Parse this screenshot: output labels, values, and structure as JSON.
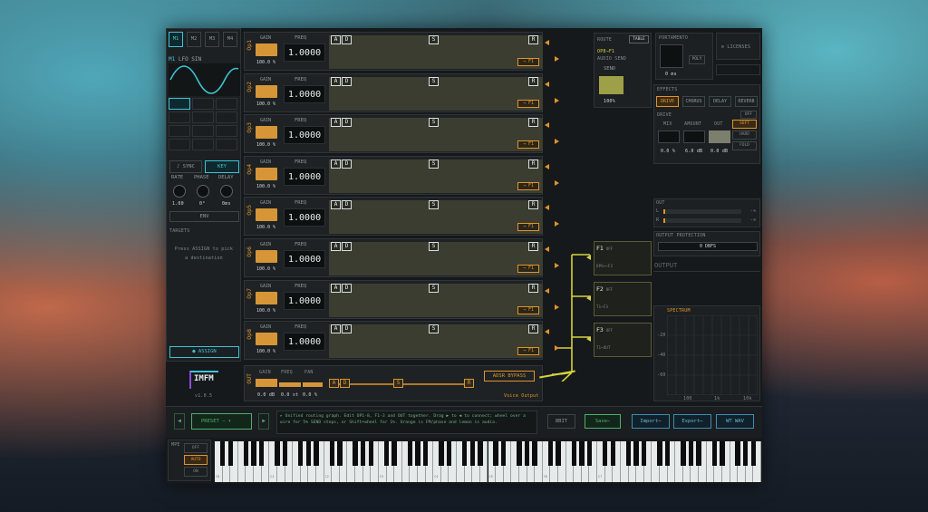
{
  "tabs": [
    "M1",
    "M2",
    "M3",
    "M4"
  ],
  "lfo": {
    "title": "M1",
    "subtitle": "LFO SIN",
    "sync_label": "♪ SYNC",
    "key_label": "KEY",
    "rate_label": "RATE",
    "phase_label": "PHASE",
    "delay_label": "DELAY",
    "rate_value": "1.00",
    "phase_value": "0°",
    "delay_value": "0ms",
    "env_label": "ENV",
    "targets_label": "TARGETS",
    "targets_hint": "Press ASSIGN to pick a destination",
    "assign_label": "● ASSIGN"
  },
  "logo": {
    "text": "IMFM",
    "version": "v1.0.5"
  },
  "operators": [
    {
      "name": "Op1",
      "gain": "100.0 %",
      "freq": "1.0000",
      "route": "→ F1"
    },
    {
      "name": "Op2",
      "gain": "100.0 %",
      "freq": "1.0000",
      "route": "→ F1"
    },
    {
      "name": "Op3",
      "gain": "100.0 %",
      "freq": "1.0000",
      "route": "→ F1"
    },
    {
      "name": "Op4",
      "gain": "100.0 %",
      "freq": "1.0000",
      "route": "→ F1"
    },
    {
      "name": "Op5",
      "gain": "100.0 %",
      "freq": "1.0000",
      "route": "→ F1"
    },
    {
      "name": "Op6",
      "gain": "100.0 %",
      "freq": "1.0000",
      "route": "→ F1"
    },
    {
      "name": "Op7",
      "gain": "100.0 %",
      "freq": "1.0000",
      "route": "→ F1"
    },
    {
      "name": "Op8",
      "gain": "100.0 %",
      "freq": "1.0000",
      "route": "→ F1"
    }
  ],
  "op_labels": {
    "gain": "GAIN",
    "freq": "FREQ",
    "a": "A",
    "d": "D",
    "s": "S",
    "r": "R"
  },
  "out_row": {
    "name": "OUT",
    "gain_label": "GAIN",
    "freq_label": "FREQ",
    "pan_label": "PAN",
    "gain_value": "0.0 dB",
    "freq_value": "0.0 st",
    "pan_value": "0.0 %",
    "bypass_label": "ADSR BYPASS",
    "voice_output": "Voice Output"
  },
  "route_panel": {
    "title": "ROUTE",
    "table_label": "TABLE",
    "line1": "OP8→F1",
    "line2": "AUDIO SEND",
    "send_label": "SEND",
    "send_value": "100%"
  },
  "filters": [
    {
      "name": "F1",
      "sub": "OFF",
      "route": "OP6+→F2"
    },
    {
      "name": "F2",
      "sub": "OFF",
      "route": "T1→F3"
    },
    {
      "name": "F3",
      "sub": "OFF",
      "route": "T1→OUT"
    }
  ],
  "portamento": {
    "title": "PORTAMENTO",
    "poly_label": "POLY",
    "value": "0 ms"
  },
  "licenses_label": "⚙ LICENSES",
  "effects": {
    "title": "EFFECTS",
    "tabs": [
      "DRIVE",
      "CHORUS",
      "DELAY",
      "REVERB"
    ],
    "off_label": "OFF",
    "drive_label": "DRIVE",
    "mix_label": "MIX",
    "amount_label": "AMOUNT",
    "out_label": "OUT",
    "mix_value": "0.0 %",
    "amount_value": "6.0 dB",
    "out_value": "0.0 dB",
    "modes": [
      "SOFT",
      "HARD",
      "FOLD"
    ]
  },
  "out_meter": {
    "title": "OUT",
    "l": "L",
    "r": "R",
    "l_db": "-∞",
    "r_db": "-∞"
  },
  "protection": {
    "title": "OUTPUT PROTECTION",
    "value": "0 DBFS"
  },
  "output_label": "OUTPUT",
  "spectrum": {
    "title": "SPECTRUM",
    "y_ticks": [
      "-20",
      "-40",
      "-60"
    ],
    "x_ticks": [
      "100",
      "1k",
      "10k"
    ]
  },
  "toolbar": {
    "preset_label": "PRESET",
    "preset_value": "— ▾",
    "hint": "▸ Unified routing graph. Edit OP1-8, F1-3 and OUT together. Drag ▶ to ◀ to connect; wheel over a wire for 5% SEND steps, or Shift+wheel for 1%. Orange is FM/phase and lemon is audio.",
    "bit_label": "8BIT",
    "save_label": "Save⋯",
    "import_label": "Import⋯",
    "export_label": "Export⋯",
    "wtwav_label": "WT WAV"
  },
  "mpe": {
    "title": "MPE",
    "modes": [
      "OFF",
      "AUTO",
      "ON"
    ]
  },
  "keyboard": {
    "octave_labels": [
      "C0",
      "C1",
      "C2",
      "C3",
      "C4",
      "C5",
      "C6",
      "C7"
    ]
  }
}
